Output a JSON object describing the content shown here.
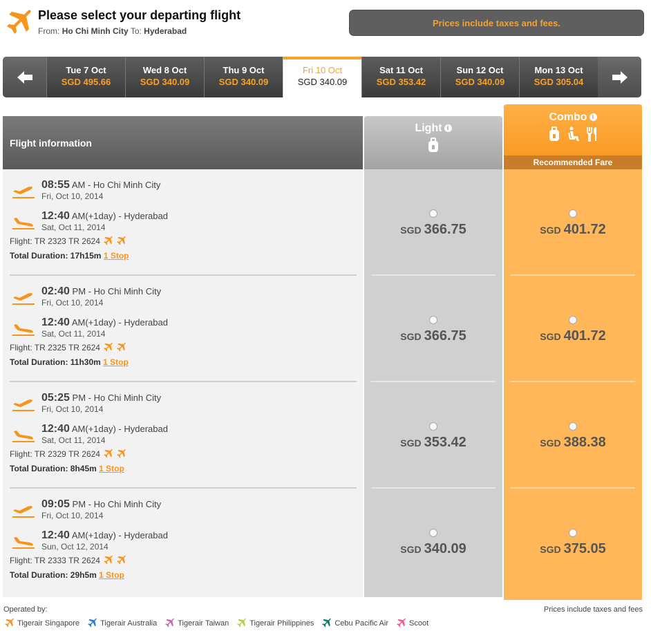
{
  "header": {
    "title": "Please select your departing flight",
    "from_label": "From:",
    "from_city": "Ho Chi Minh City",
    "to_label": "To:",
    "to_city": "Hyderabad",
    "tax_banner": "Prices include taxes and fees."
  },
  "dates": [
    {
      "day": "Tue 7 Oct",
      "price": "SGD 495.66"
    },
    {
      "day": "Wed 8 Oct",
      "price": "SGD 340.09"
    },
    {
      "day": "Thu 9 Oct",
      "price": "SGD 340.09"
    },
    {
      "day": "Fri 10 Oct",
      "price": "SGD 340.09",
      "active": true
    },
    {
      "day": "Sat 11 Oct",
      "price": "SGD 353.42"
    },
    {
      "day": "Sun 12 Oct",
      "price": "SGD 340.09"
    },
    {
      "day": "Mon 13 Oct",
      "price": "SGD 305.04"
    }
  ],
  "columns": {
    "info": "Flight information",
    "light": "Light",
    "combo": "Combo",
    "recommended": "Recommended Fare"
  },
  "flights": [
    {
      "dep_time": "08:55",
      "dep_ampm": "AM",
      "dep_city": "- Ho Chi Minh City",
      "dep_date": "Fri, Oct 10, 2014",
      "arr_time": "12:40",
      "arr_ampm": "AM(+1day)",
      "arr_city": "- Hyderabad",
      "arr_date": "Sat, Oct 11, 2014",
      "flight_no": "Flight: TR 2323 TR 2624",
      "duration_label": "Total Duration:",
      "duration": "17h15m",
      "stops": "1 Stop",
      "light_cur": "SGD",
      "light_price": "366.75",
      "combo_cur": "SGD",
      "combo_price": "401.72"
    },
    {
      "dep_time": "02:40",
      "dep_ampm": "PM",
      "dep_city": "- Ho Chi Minh City",
      "dep_date": "Fri, Oct 10, 2014",
      "arr_time": "12:40",
      "arr_ampm": "AM(+1day)",
      "arr_city": "- Hyderabad",
      "arr_date": "Sat, Oct 11, 2014",
      "flight_no": "Flight: TR 2325 TR 2624",
      "duration_label": "Total Duration:",
      "duration": "11h30m",
      "stops": "1 Stop",
      "light_cur": "SGD",
      "light_price": "366.75",
      "combo_cur": "SGD",
      "combo_price": "401.72"
    },
    {
      "dep_time": "05:25",
      "dep_ampm": "PM",
      "dep_city": "- Ho Chi Minh City",
      "dep_date": "Fri, Oct 10, 2014",
      "arr_time": "12:40",
      "arr_ampm": "AM(+1day)",
      "arr_city": "- Hyderabad",
      "arr_date": "Sat, Oct 11, 2014",
      "flight_no": "Flight: TR 2329 TR 2624",
      "duration_label": "Total Duration:",
      "duration": "8h45m",
      "stops": "1 Stop",
      "light_cur": "SGD",
      "light_price": "353.42",
      "combo_cur": "SGD",
      "combo_price": "388.38"
    },
    {
      "dep_time": "09:05",
      "dep_ampm": "PM",
      "dep_city": "- Ho Chi Minh City",
      "dep_date": "Fri, Oct 10, 2014",
      "arr_time": "12:40",
      "arr_ampm": "AM(+1day)",
      "arr_city": "- Hyderabad",
      "arr_date": "Sun, Oct 12, 2014",
      "flight_no": "Flight: TR 2333 TR 2624",
      "duration_label": "Total Duration:",
      "duration": "29h5m",
      "stops": "1 Stop",
      "light_cur": "SGD",
      "light_price": "340.09",
      "combo_cur": "SGD",
      "combo_price": "375.05"
    }
  ],
  "footer": {
    "operated_by": "Operated by:",
    "tax_note": "Prices include taxes and fees",
    "airlines": [
      {
        "name": "Tigerair Singapore",
        "color": "#f7941d"
      },
      {
        "name": "Tigerair Australia",
        "color": "#2a7fd4"
      },
      {
        "name": "Tigerair Taiwan",
        "color": "#c46bb4"
      },
      {
        "name": "Tigerair Philippines",
        "color": "#b6cf3a"
      },
      {
        "name": "Cebu Pacific Air",
        "color": "#0f7a6a"
      },
      {
        "name": "Scoot",
        "color": "#ef5a9a"
      }
    ]
  },
  "colors": {
    "accent": "#f7941d",
    "dark": "#4d4d4d"
  }
}
